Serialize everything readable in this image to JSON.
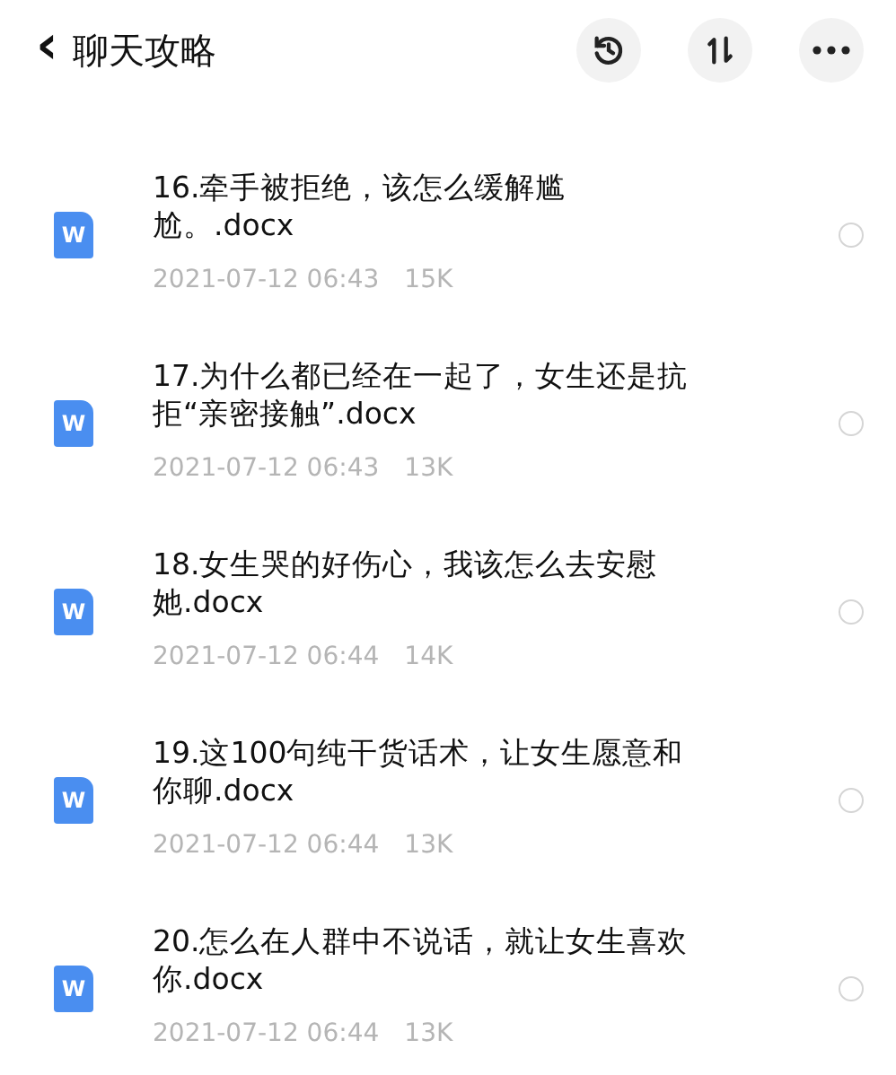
{
  "header": {
    "back_icon": "‹",
    "title": "聊天攻略"
  },
  "files": [
    {
      "icon_letter": "W",
      "name": "16.牵手被拒绝，该怎么缓解尴尬。.docx",
      "date": "2021-07-12 06:43",
      "size": "15K",
      "selected": false
    },
    {
      "icon_letter": "W",
      "name": "17.为什么都已经在一起了，女生还是抗拒“亲密接触”.docx",
      "date": "2021-07-12 06:43",
      "size": "13K",
      "selected": false
    },
    {
      "icon_letter": "W",
      "name": "18.女生哭的好伤心，我该怎么去安慰她.docx",
      "date": "2021-07-12 06:44",
      "size": "14K",
      "selected": false
    },
    {
      "icon_letter": "W",
      "name": "19.这100句纯干货话术，让女生愿意和你聊.docx",
      "date": "2021-07-12 06:44",
      "size": "13K",
      "selected": false
    },
    {
      "icon_letter": "W",
      "name": "20.怎么在人群中不说话，就让女生喜欢你.docx",
      "date": "2021-07-12 06:44",
      "size": "13K",
      "selected": false
    }
  ]
}
